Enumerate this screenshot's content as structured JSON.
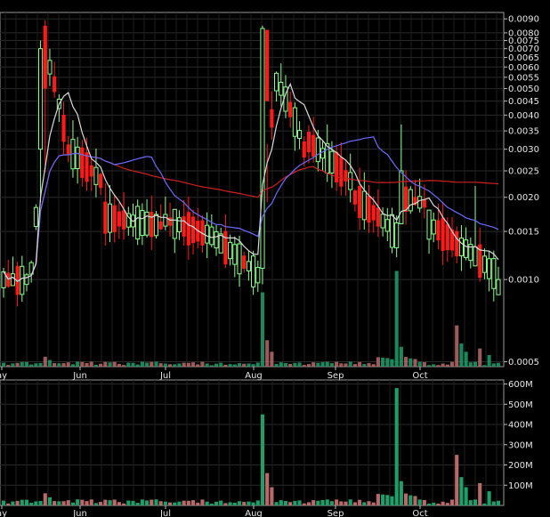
{
  "chart_data": [
    {
      "type": "candlestick",
      "panel": "price",
      "y_scale": "log",
      "ylim": [
        0.00048,
        0.0095
      ],
      "y_ticks": [
        "0.0090",
        "0.0080",
        "0.0075",
        "0.0070",
        "0.0065",
        "0.0060",
        "0.0055",
        "0.0050",
        "0.0045",
        "0.0040",
        "0.0035",
        "0.0030",
        "0.0025",
        "0.0020",
        "0.0015",
        "0.0010",
        "0.0005"
      ],
      "x_labels": [
        "ay",
        "Jun",
        "Jul",
        "Aug",
        "Sep",
        "Oct"
      ],
      "grid": true,
      "colors": {
        "up": "#8bff8b",
        "down": "#ff1a1a",
        "ma_short": "#d9d9d9",
        "ma_mid": "#6b6bff",
        "ma_long": "#d02020",
        "volume_up": "#1f9e6a",
        "volume_down": "#b86a6a"
      },
      "volume_overlay": true
    },
    {
      "type": "bar",
      "panel": "volume",
      "ylim": [
        0,
        620
      ],
      "y_ticks": [
        "600M",
        "500M",
        "400M",
        "300M",
        "200M",
        "100M"
      ],
      "x_labels": [
        "ay",
        "Jun",
        "Jul",
        "Aug",
        "Sep",
        "Oct"
      ],
      "grid": true,
      "spikes": {
        "late_jul": 450,
        "mid_sep": 580,
        "mid_oct": 250
      }
    }
  ]
}
